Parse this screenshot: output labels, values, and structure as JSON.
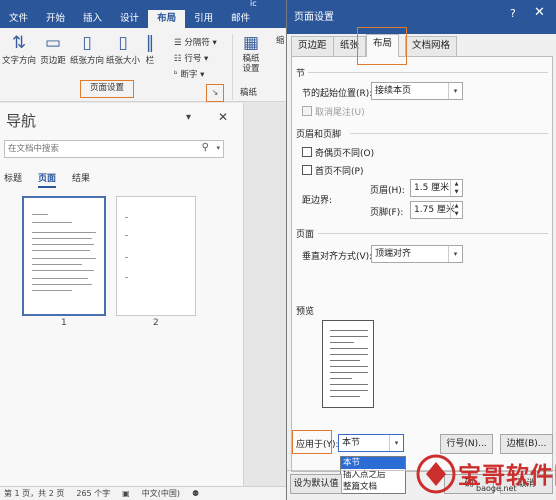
{
  "word": {
    "title_partial": "ic",
    "tabs": [
      "文件",
      "开始",
      "插入",
      "设计",
      "布局",
      "引用",
      "邮件"
    ],
    "ribbon": {
      "text_direction": "文字方向",
      "margins": "页边距",
      "orientation": "纸张方向",
      "size": "纸张大小",
      "columns": "栏",
      "breaks": "分隔符",
      "line_numbers": "行号",
      "hyphenation": "断字",
      "group_label": "页面设置",
      "indent_partial": "缩",
      "draft_paper": "稿纸\n设置",
      "draft_group": "稿纸"
    },
    "nav": {
      "title": "导航",
      "search_placeholder": "在文档中搜索",
      "tabs": [
        "标题",
        "页面",
        "结果"
      ],
      "page_numbers": [
        "1",
        "2"
      ]
    },
    "status": {
      "page": "第 1 页，共 2 页",
      "words": "265 个字",
      "lang": "中文(中国)"
    }
  },
  "dialog": {
    "title": "页面设置",
    "help": "?",
    "tabs": [
      "页边距",
      "纸张",
      "布局",
      "文档网格"
    ],
    "section": {
      "header": "节",
      "start_label": "节的起始位置(R):",
      "start_value": "接续本页",
      "suppress_endnotes": "取消尾注(U)"
    },
    "headers_footers": {
      "header": "页眉和页脚",
      "odd_even": "奇偶页不同(O)",
      "first_page": "首页不同(P)",
      "from_edge": "距边界:",
      "header_label": "页眉(H):",
      "header_value": "1.5 厘米",
      "footer_label": "页脚(F):",
      "footer_value": "1.75 厘米"
    },
    "page": {
      "header": "页面",
      "valign_label": "垂直对齐方式(V):",
      "valign_value": "顶端对齐"
    },
    "preview": {
      "header": "预览"
    },
    "apply": {
      "label": "应用于(Y):",
      "value": "本节",
      "options": [
        "本节",
        "插入点之后",
        "整篇文档"
      ],
      "selected_index": 0
    },
    "buttons": {
      "line_numbers": "行号(N)...",
      "borders": "边框(B)...",
      "set_default": "设为默认值",
      "ok": "确",
      "cancel": "取消"
    }
  },
  "watermark": {
    "text": "宝哥软件园",
    "url": "baoge.net"
  },
  "colors": {
    "accent": "#2b579a",
    "highlight": "#e07a2e",
    "selection": "#2b6dd4",
    "watermark": "#cc2e2e"
  }
}
